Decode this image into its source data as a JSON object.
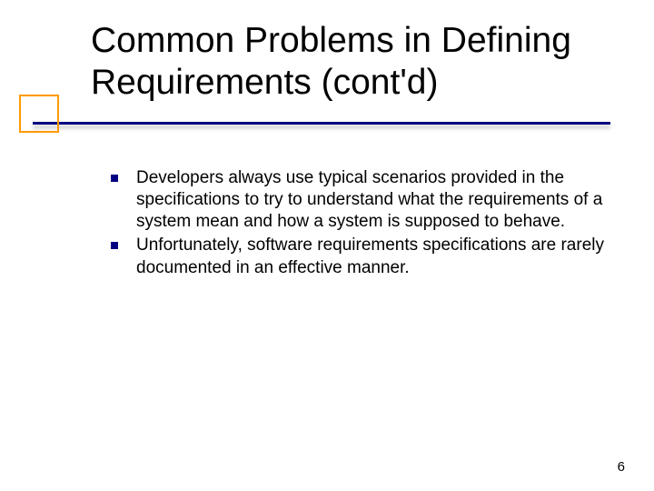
{
  "title": "Common Problems in Defining Requirements (cont'd)",
  "bullets": [
    "Developers always use typical scenarios provided in the specifications to try to understand what the requirements of a system mean and how a system is supposed to behave.",
    "Unfortunately, software requirements specifications are rarely documented in an effective manner."
  ],
  "page_number": "6"
}
